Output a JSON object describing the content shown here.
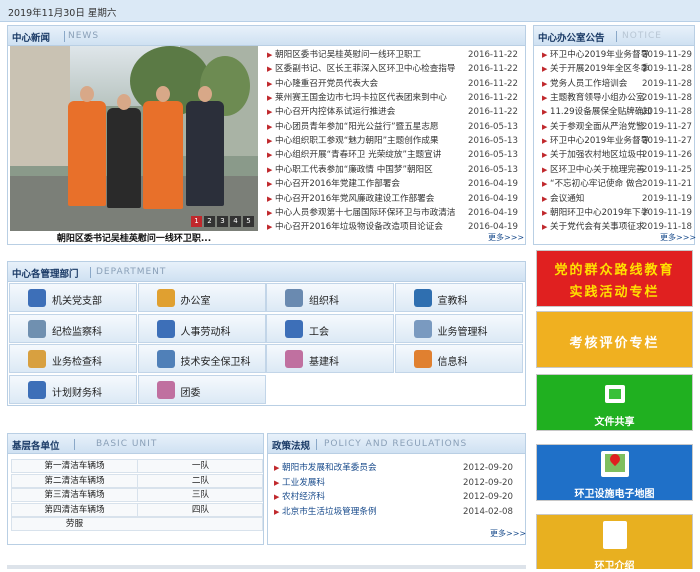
{
  "date_bar": "2019年11月30日   星期六",
  "center_news": {
    "title": "中心新闻",
    "title_en": "NEWS",
    "photo_caption": "朝阳区委书记吴桂英慰问一线环卫职...",
    "slide_numbers": [
      "1",
      "2",
      "3",
      "4",
      "5"
    ],
    "items": [
      {
        "title": "朝阳区委书记吴桂英慰问一线环卫职工",
        "date": "2016-11-22"
      },
      {
        "title": "区委副书记、区长王菲深入区环卫中心检查指导",
        "date": "2016-11-22"
      },
      {
        "title": "中心隆重召开党员代表大会",
        "date": "2016-11-22"
      },
      {
        "title": "莱州赛王国金边市七玛卡拉区代表团来到中心",
        "date": "2016-11-22"
      },
      {
        "title": "中心召开内控体系试运行推进会",
        "date": "2016-11-22"
      },
      {
        "title": "中心团员青年参加“阳光公益行”暨五星志愿",
        "date": "2016-05-13"
      },
      {
        "title": "中心组织职工参观“魅力朝阳”主题创作成果",
        "date": "2016-05-13"
      },
      {
        "title": "中心组织开展“青春环卫 光荣绽放”主题宣讲",
        "date": "2016-05-13"
      },
      {
        "title": "中心职工代表参加“廉政情 中国梦”朝阳区",
        "date": "2016-05-13"
      },
      {
        "title": "中心召开2016年党建工作部署会",
        "date": "2016-04-19"
      },
      {
        "title": "中心召开2016年党风廉政建设工作部署会",
        "date": "2016-04-19"
      },
      {
        "title": "中心人员参观第十七届国际环保环卫与市政清洁",
        "date": "2016-04-19"
      },
      {
        "title": "中心召开2016年垃圾物设备改造项目论证会",
        "date": "2016-04-19"
      }
    ],
    "more": "更多>>>"
  },
  "notice": {
    "title": "中心办公室公告",
    "title_en": "NOTICE",
    "items": [
      {
        "title": "环卫中心2019年业务督导",
        "date": "2019-11-29"
      },
      {
        "title": "关于开展2019年全区冬季",
        "date": "2019-11-28"
      },
      {
        "title": "党务人员工作培训会",
        "date": "2019-11-28"
      },
      {
        "title": "主题教育领导小组办公室",
        "date": "2019-11-28"
      },
      {
        "title": "11.29设备展保全贴牌确知",
        "date": "2019-11-28"
      },
      {
        "title": "关于参观全面从严治党警",
        "date": "2019-11-27"
      },
      {
        "title": "环卫中心2019年业务督导",
        "date": "2019-11-27"
      },
      {
        "title": "关于加强农村地区垃圾中",
        "date": "2019-11-26"
      },
      {
        "title": "区环卫中心关于梳理完善",
        "date": "2019-11-25"
      },
      {
        "title": "“不忘初心牢记使命 做合",
        "date": "2019-11-21"
      },
      {
        "title": "会议通知",
        "date": "2019-11-19"
      },
      {
        "title": "朝阳环卫中心2019年下半",
        "date": "2019-11-19"
      },
      {
        "title": "关于党代会有关事项征求",
        "date": "2019-11-18"
      }
    ],
    "more": "更多>>>"
  },
  "departments": {
    "title": "中心各管理部门",
    "title_en": "DEPARTMENT",
    "items": [
      {
        "label": "机关党支部",
        "icon": "person-icon",
        "color": "#3d6fb8"
      },
      {
        "label": "办公室",
        "icon": "document-icon",
        "color": "#e0a030"
      },
      {
        "label": "组织科",
        "icon": "table-icon",
        "color": "#6a8ab0"
      },
      {
        "label": "宣教科",
        "icon": "books-icon",
        "color": "#2f6fb0"
      },
      {
        "label": "纪检监察科",
        "icon": "checklist-icon",
        "color": "#7090b0"
      },
      {
        "label": "人事劳动科",
        "icon": "person-icon",
        "color": "#3d6fb8"
      },
      {
        "label": "工会",
        "icon": "group-icon",
        "color": "#3d6fb8"
      },
      {
        "label": "业务管理科",
        "icon": "folder-icon",
        "color": "#7a9ac0"
      },
      {
        "label": "业务检查科",
        "icon": "clipboard-icon",
        "color": "#d8a040"
      },
      {
        "label": "技术安全保卫科",
        "icon": "shield-icon",
        "color": "#5080b8"
      },
      {
        "label": "基建科",
        "icon": "worker-icon",
        "color": "#c070a0"
      },
      {
        "label": "信息科",
        "icon": "house-icon",
        "color": "#e08030"
      },
      {
        "label": "计划财务科",
        "icon": "books-icon",
        "color": "#3d6fb8"
      },
      {
        "label": "团委",
        "icon": "person-icon",
        "color": "#c070a0"
      }
    ]
  },
  "basic_unit": {
    "title": "基层各单位",
    "title_en": "BASIC UNIT",
    "rows": [
      {
        "name": "第一清洁车辆场",
        "team": "一队"
      },
      {
        "name": "第二清洁车辆场",
        "team": "二队"
      },
      {
        "name": "第三清洁车辆场",
        "team": "三队"
      },
      {
        "name": "第四清洁车辆场",
        "team": "四队"
      },
      {
        "name": "劳服",
        "team": ""
      }
    ]
  },
  "policy": {
    "title": "政策法规",
    "title_en": "POLICY AND REGULATIONS",
    "items": [
      {
        "title": "朝阳市发展和改革委员会",
        "date": "2012-09-20"
      },
      {
        "title": "工业发展科",
        "date": "2012-09-20"
      },
      {
        "title": "农村经济科",
        "date": "2012-09-20"
      },
      {
        "title": "北京市生活垃圾管理条例",
        "date": "2014-02-08"
      }
    ],
    "more": "更多>>>"
  },
  "banners": [
    {
      "label": "党的群众路线教育实践活动专栏",
      "line1": "党的群众路线教育",
      "line2": "实践活动专栏",
      "bg": "#e02020",
      "fg": "#ffe000"
    },
    {
      "label": "考核评价专栏",
      "bg": "#f0b020",
      "fg": "#ffffff"
    },
    {
      "label": "文件共享",
      "bg": "#20b020",
      "fg": "#ffffff",
      "icon": "file-share-icon"
    },
    {
      "label": "环卫设施电子地图",
      "bg": "#1f70c8",
      "fg": "#ffffff",
      "icon": "map-icon"
    },
    {
      "label": "环卫介绍",
      "bg": "#e8b020",
      "fg": "#ffffff"
    }
  ]
}
